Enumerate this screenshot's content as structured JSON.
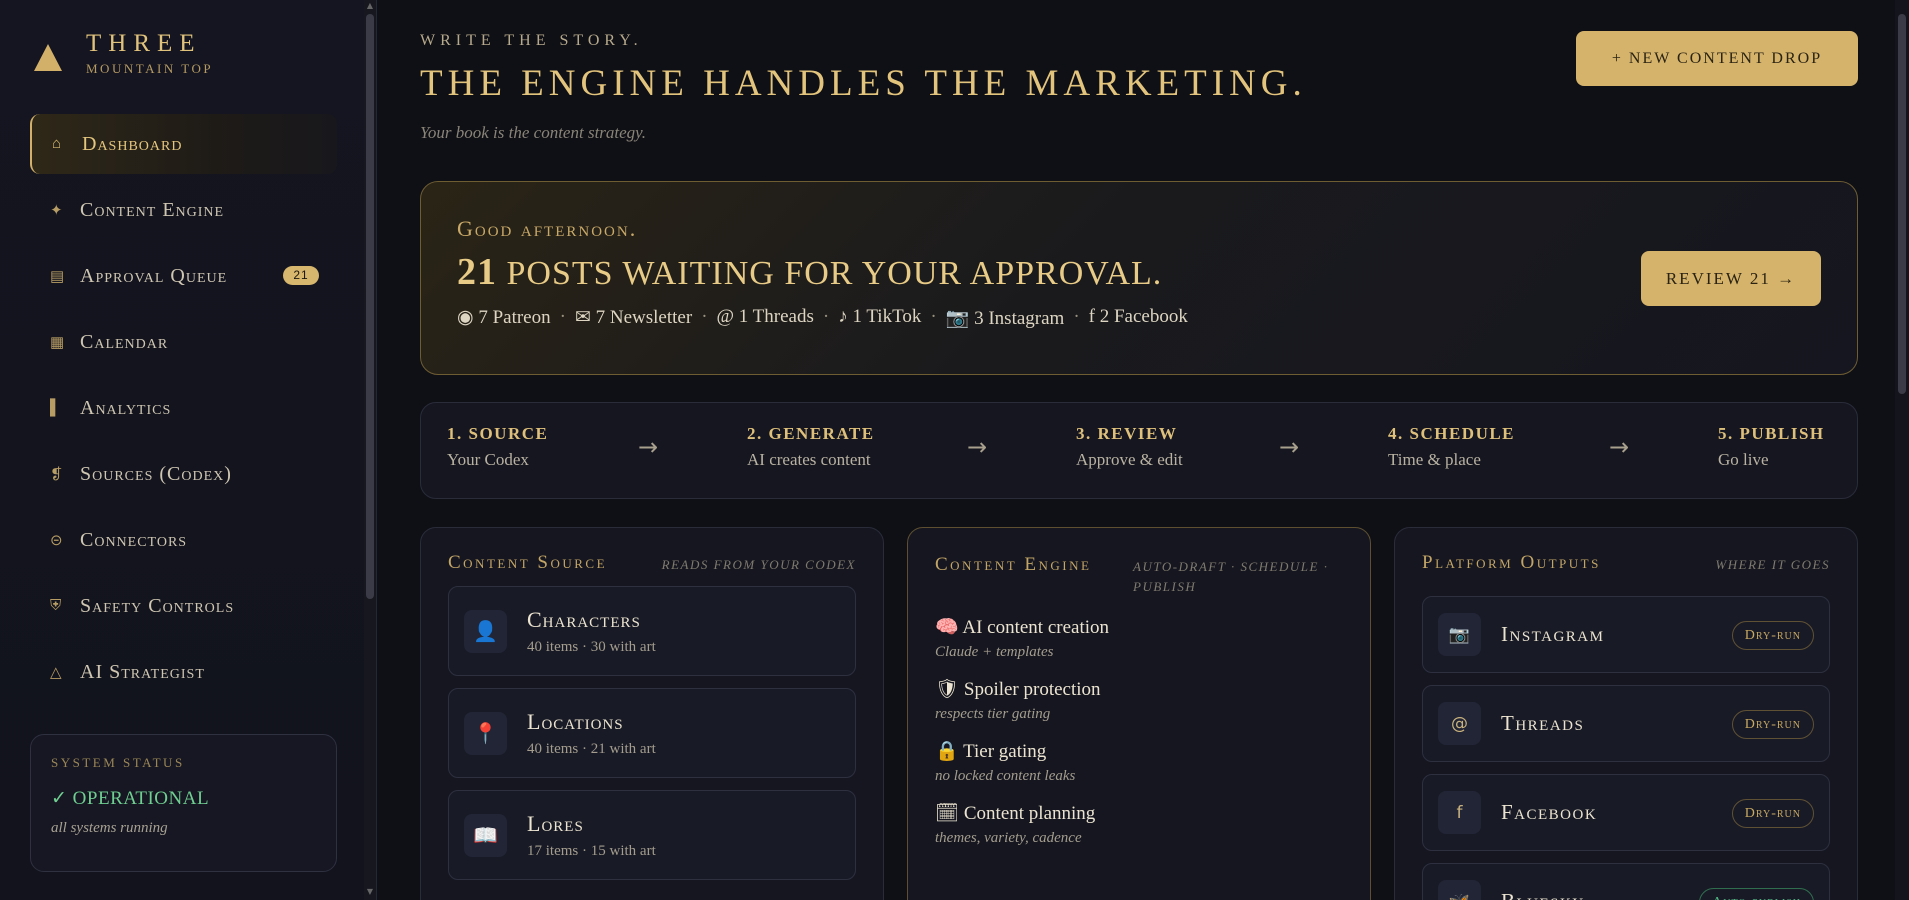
{
  "brand": {
    "name": "THREE",
    "sub": "MOUNTAIN TOP"
  },
  "sidebar": {
    "items": [
      {
        "label": "Dashboard",
        "icon": "⌂"
      },
      {
        "label": "Content Engine",
        "icon": "✦"
      },
      {
        "label": "Approval Queue",
        "icon": "▤",
        "badge": "21"
      },
      {
        "label": "Calendar",
        "icon": "▦"
      },
      {
        "label": "Analytics",
        "icon": "▌"
      },
      {
        "label": "Sources (Codex)",
        "icon": "❡"
      },
      {
        "label": "Connectors",
        "icon": "⊝"
      },
      {
        "label": "Safety Controls",
        "icon": "⛨"
      },
      {
        "label": "AI Strategist",
        "icon": "△"
      }
    ],
    "status": {
      "label": "System Status",
      "value": "✓ OPERATIONAL",
      "note": "all systems running"
    }
  },
  "header": {
    "eyebrow": "WRITE THE STORY.",
    "title": "THE ENGINE HANDLES THE MARKETING.",
    "tagline": "Your book is the content strategy.",
    "new_button": "+ NEW CONTENT DROP"
  },
  "hero": {
    "greeting": "Good afternoon.",
    "count": "21",
    "message": " POSTS WAITING FOR YOUR APPROVAL.",
    "counts": [
      "◉ 7 Patreon",
      "✉ 7 Newsletter",
      "@ 1 Threads",
      "♪ 1 TikTok",
      "📷 3 Instagram",
      "f 2 Facebook"
    ],
    "separator": "·",
    "review_button": "REVIEW 21 →"
  },
  "pipeline": {
    "arrow": "→",
    "steps": [
      {
        "title": "1. SOURCE",
        "desc": "Your Codex"
      },
      {
        "title": "2. GENERATE",
        "desc": "AI creates content"
      },
      {
        "title": "3. REVIEW",
        "desc": "Approve & edit"
      },
      {
        "title": "4. SCHEDULE",
        "desc": "Time & place"
      },
      {
        "title": "5. PUBLISH",
        "desc": "Go live"
      }
    ]
  },
  "content_source": {
    "title": "Content Source",
    "subtitle": "READS FROM YOUR CODEX",
    "items": [
      {
        "name": "Characters",
        "meta": "40 items · 30 with art",
        "icon": "👤"
      },
      {
        "name": "Locations",
        "meta": "40 items · 21 with art",
        "icon": "📍"
      },
      {
        "name": "Lores",
        "meta": "17 items · 15 with art",
        "icon": "📖"
      }
    ]
  },
  "content_engine": {
    "title": "Content Engine",
    "subtitle": "AUTO-DRAFT · SCHEDULE · PUBLISH",
    "items": [
      {
        "name": "🧠 AI content creation",
        "desc": "Claude + templates"
      },
      {
        "name": "🛡 Spoiler protection",
        "desc": "respects tier gating"
      },
      {
        "name": "🔒 Tier gating",
        "desc": "no locked content leaks"
      },
      {
        "name": "🗓 Content planning",
        "desc": "themes, variety, cadence"
      }
    ]
  },
  "platform_outputs": {
    "title": "Platform Outputs",
    "subtitle": "WHERE IT GOES",
    "items": [
      {
        "name": "Instagram",
        "status": "Dry-run",
        "icon": "📷"
      },
      {
        "name": "Threads",
        "status": "Dry-run",
        "icon": "@"
      },
      {
        "name": "Facebook",
        "status": "Dry-run",
        "icon": "f"
      },
      {
        "name": "Bluesky",
        "status": "Auto-publish",
        "icon": "🦋"
      }
    ]
  },
  "colors": {
    "accent": "#d5b36b",
    "background": "#0f1016",
    "success": "#6fcf91"
  }
}
